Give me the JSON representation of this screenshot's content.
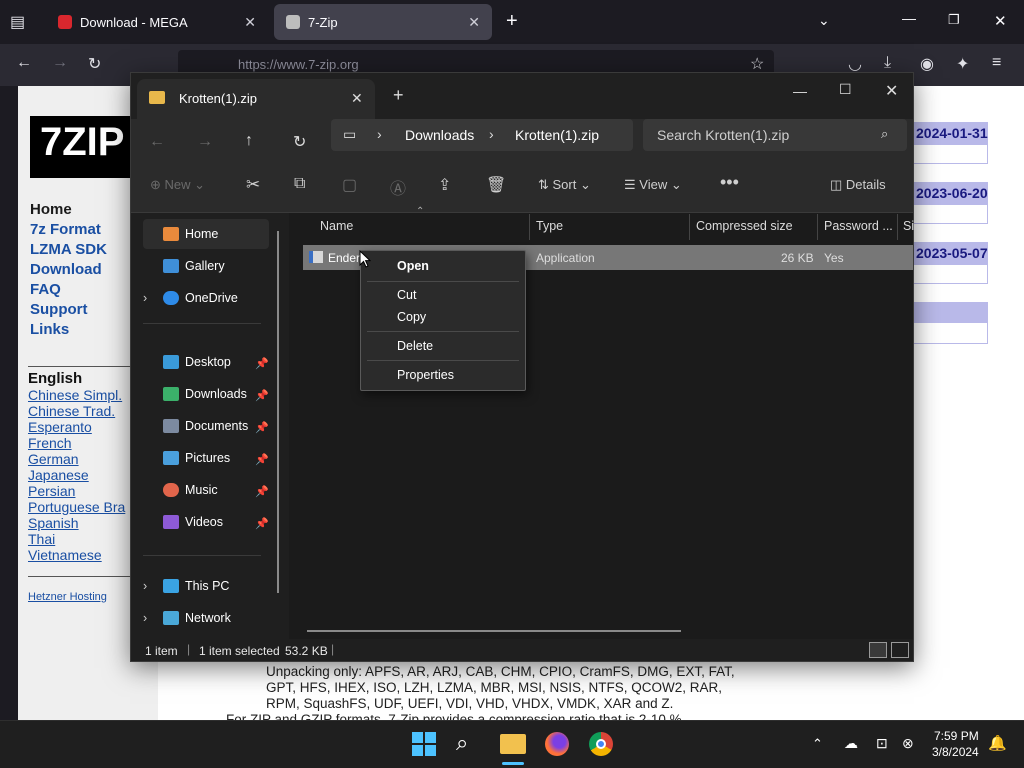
{
  "browser": {
    "tabs": [
      {
        "title": "Download - MEGA"
      },
      {
        "title": "7-Zip"
      }
    ],
    "url": "https://www.7-zip.org"
  },
  "website": {
    "nav": [
      "Home",
      "7z Format",
      "LZMA SDK",
      "Download",
      "FAQ",
      "Support",
      "Links"
    ],
    "language_heading": "English",
    "languages": [
      "Chinese Simpl.",
      "Chinese Trad.",
      "Esperanto",
      "French",
      "German",
      "Japanese",
      "Persian",
      "Portuguese Bra",
      "Spanish",
      "Thai",
      "Vietnamese"
    ],
    "hosting": "Hetzner Hosting",
    "dates": [
      "2024-01-31",
      "2023-06-20",
      "2023-05-07"
    ],
    "body_text": "Unpacking only: APFS, AR, ARJ, CAB, CHM, CPIO, CramFS, DMG, EXT, FAT, GPT, HFS, IHEX, ISO, LZH, LZMA, MBR, MSI, NSIS, NTFS, QCOW2, RAR, RPM, SquashFS, UDF, UEFI, VDI, VHD, VHDX, VMDK, XAR and Z.",
    "body_text2": "For ZIP and GZIP formats, 7-Zip provides a compression ratio that is 2-10 %"
  },
  "explorer": {
    "tab_title": "Krotten(1).zip",
    "breadcrumb": [
      "Downloads",
      "Krotten(1).zip"
    ],
    "search_placeholder": "Search Krotten(1).zip",
    "toolbar": {
      "new": "New",
      "sort": "Sort",
      "view": "View",
      "details": "Details"
    },
    "sidebar": {
      "top": [
        "Home",
        "Gallery",
        "OneDrive"
      ],
      "pinned": [
        "Desktop",
        "Downloads",
        "Documents",
        "Pictures",
        "Music",
        "Videos"
      ],
      "bottom": [
        "This PC",
        "Network"
      ]
    },
    "columns": [
      "Name",
      "Type",
      "Compressed size",
      "Password ...",
      "Si"
    ],
    "file": {
      "name": "Ender",
      "type": "Application",
      "size": "26 KB",
      "password": "Yes"
    },
    "status": {
      "count": "1 item",
      "selected": "1 item selected",
      "size": "53.2 KB"
    }
  },
  "context_menu": [
    "Open",
    "Cut",
    "Copy",
    "Delete",
    "Properties"
  ],
  "taskbar": {
    "time": "7:59 PM",
    "date": "3/8/2024"
  },
  "colors": {
    "accent": "#4cc2ff",
    "selection": "#777777",
    "date_box": "#b9b9e9"
  }
}
